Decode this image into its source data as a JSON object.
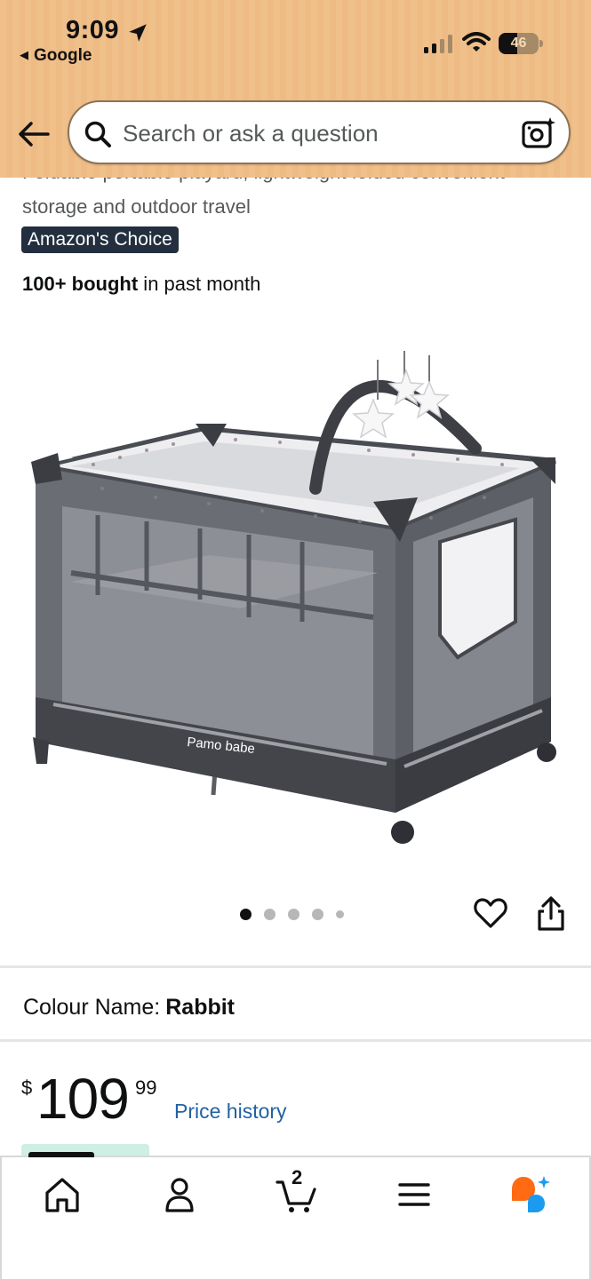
{
  "status_bar": {
    "time": "9:09",
    "back_app": "Google",
    "battery": "46",
    "battery_level": 0.46
  },
  "search": {
    "placeholder": "Search or ask a question"
  },
  "product": {
    "title_partial": "Foldable portable playard, lightweight folded convenient storage and outdoor travel",
    "title_line1": "Foldable portable playard, lightweight folded convenient",
    "title_line2": "storage and outdoor travel",
    "badge": "Amazon's Choice",
    "bought_bold": "100+ bought",
    "bought_rest": " in past month",
    "image_brand": "Pamo babe",
    "image_count": 5,
    "active_image": 1,
    "colour_label": "Colour Name:",
    "colour_value": "Rabbit",
    "price_symbol": "$",
    "price_whole": "109",
    "price_fraction": "99",
    "price_history": "Price history"
  },
  "bottom_nav": {
    "cart_count": "2",
    "items": [
      "home-icon",
      "account-icon",
      "cart-icon",
      "menu-icon",
      "rufus-icon"
    ],
    "accent_orange": "#ff6a13",
    "accent_blue": "#1a9bf0"
  },
  "colors": {
    "header_bg": "#f0c08b",
    "badge_bg": "#232f3e",
    "link": "#2162a1",
    "text": "#0f1111"
  }
}
